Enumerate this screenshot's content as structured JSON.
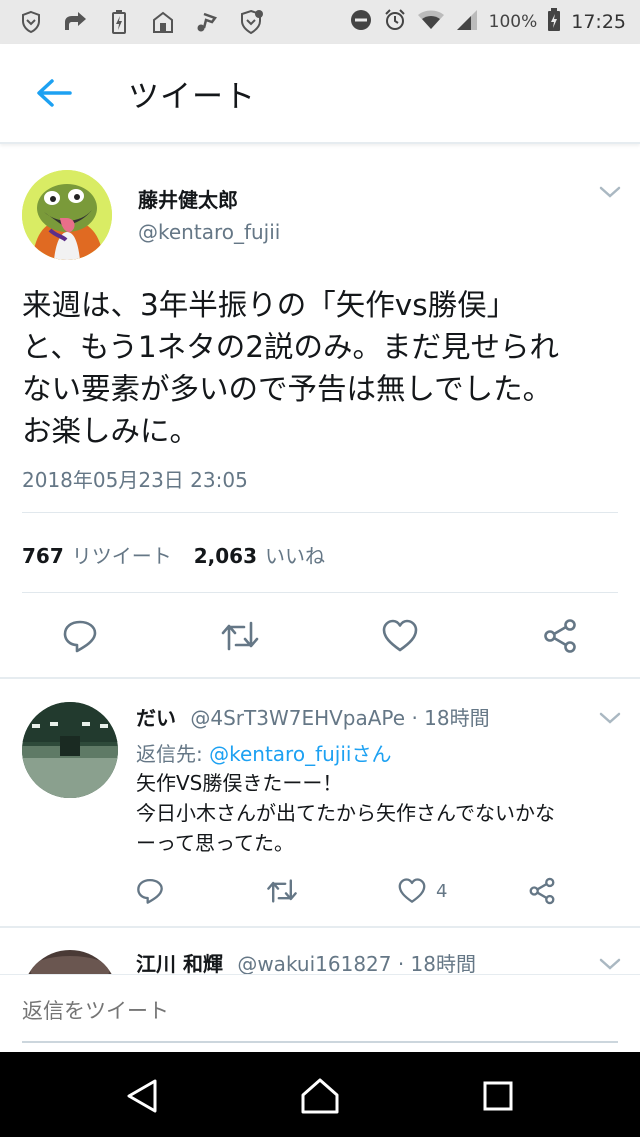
{
  "status_bar": {
    "battery": "100%",
    "time": "17:25"
  },
  "toolbar": {
    "title": "ツイート"
  },
  "tweet": {
    "author_name": "藤井健太郎",
    "author_handle": "@kentaro_fujii",
    "text": "来週は、3年半振りの「矢作vs勝俣」\nと、もう1ネタの2説のみ。まだ見せられ\nない要素が多いので予告は無しでした。\nお楽しみに。",
    "timestamp": "2018年05月23日 23:05",
    "retweet_count": "767",
    "retweet_label": "リツイート",
    "like_count": "2,063",
    "like_label": "いいね"
  },
  "replies": [
    {
      "name": "だい",
      "meta": "@4SrT3W7EHVpaAPe · 18時間",
      "reply_to_prefix": "返信先: ",
      "reply_to_mention": "@kentaro_fujiiさん",
      "text": "矢作VS勝俣きたーー！\n今日小木さんが出てたから矢作さんでないかな\nーって思ってた。",
      "like_count": "4"
    },
    {
      "name": "江川 和輝",
      "meta": "@wakui161827 · 18時間"
    }
  ],
  "composer": {
    "placeholder": "返信をツイート"
  },
  "colors": {
    "accent": "#1da1f2",
    "secondary_text": "#657786",
    "status_bar_bg": "#e9e9e9",
    "nav_bar_bg": "#000000"
  }
}
